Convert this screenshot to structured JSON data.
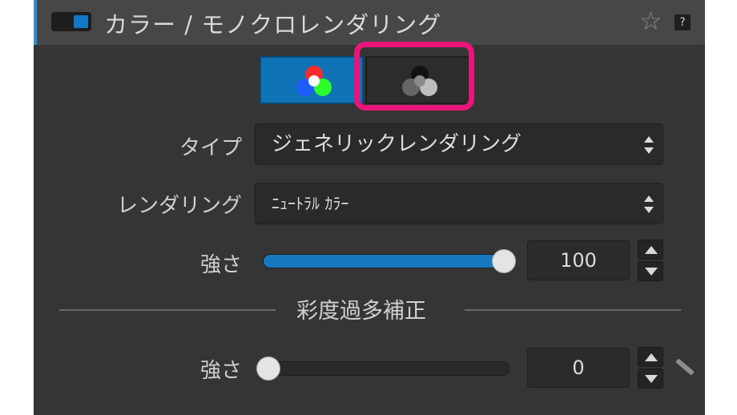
{
  "header": {
    "title": "カラー / モノクロレンダリング",
    "star_icon": "☆",
    "help_label": "?"
  },
  "mode_buttons": [
    {
      "name": "color",
      "icon": "rgb-circles-icon",
      "selected": true
    },
    {
      "name": "monochrome",
      "icon": "gray-circles-icon",
      "selected": false,
      "highlighted": true
    }
  ],
  "type_row": {
    "label": "タイプ",
    "value": "ジェネリックレンダリング"
  },
  "rendering_row": {
    "label": "レンダリング",
    "value": "ﾆｭｰﾄﾗﾙ ｶﾗｰ"
  },
  "strength_row": {
    "label": "強さ",
    "value": "100",
    "fraction": 1.0
  },
  "saturation_section": {
    "title": "彩度過多補正",
    "strength_label": "強さ",
    "strength_value": "0",
    "fraction": 0.0
  },
  "colors": {
    "accent": "#1679c0",
    "highlight": "#e8157a",
    "panel": "#353535"
  }
}
